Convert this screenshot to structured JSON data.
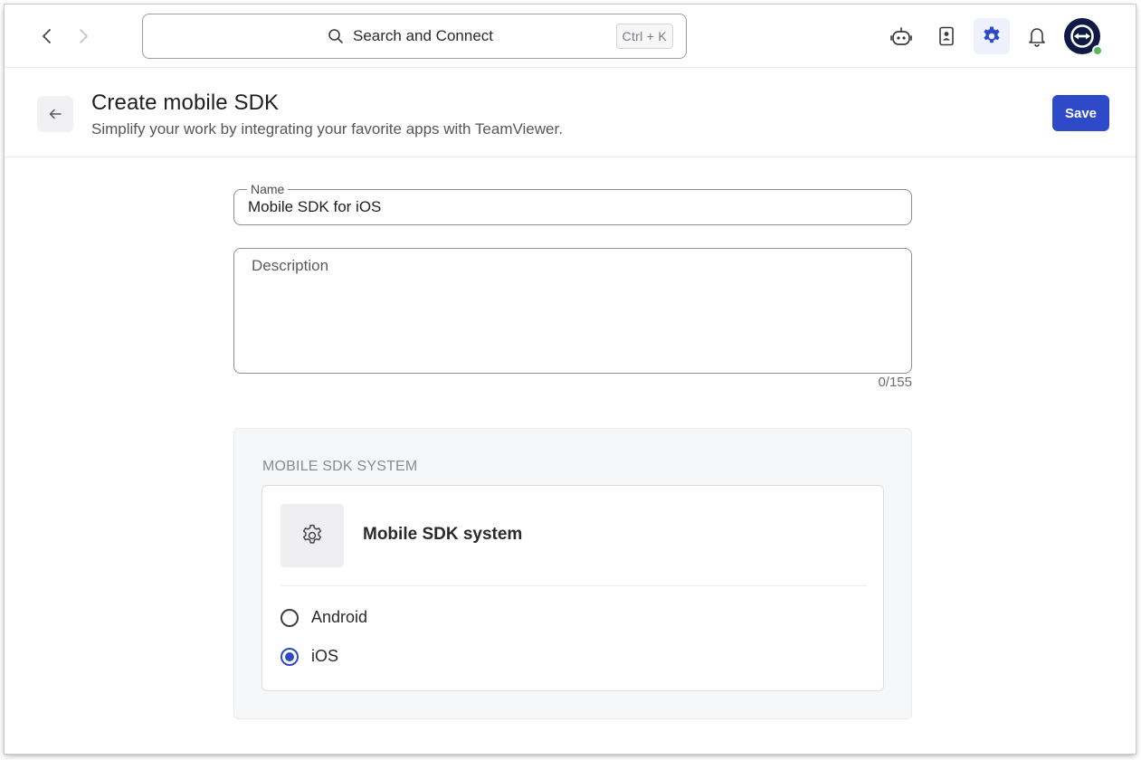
{
  "topbar": {
    "search_label": "Search and Connect",
    "search_shortcut": "Ctrl + K",
    "accent_color": "#2f4ac9"
  },
  "header": {
    "title": "Create mobile SDK",
    "subtitle": "Simplify your work by integrating your favorite apps with TeamViewer.",
    "save_label": "Save"
  },
  "form": {
    "name_label": "Name",
    "name_value": "Mobile SDK for iOS",
    "description_placeholder": "Description",
    "description_counter": "0/155"
  },
  "sdk_system": {
    "section_heading": "MOBILE SDK SYSTEM",
    "card_title": "Mobile SDK system",
    "options": [
      {
        "label": "Android",
        "selected": false
      },
      {
        "label": "iOS",
        "selected": true
      }
    ]
  },
  "icons": {
    "back": "chevron-left-icon",
    "forward": "chevron-right-icon",
    "search": "search-icon",
    "assistant": "robot-icon",
    "contacts": "contacts-book-icon",
    "settings": "gear-icon",
    "notifications": "bell-icon",
    "avatar": "teamviewer-logo-icon"
  }
}
